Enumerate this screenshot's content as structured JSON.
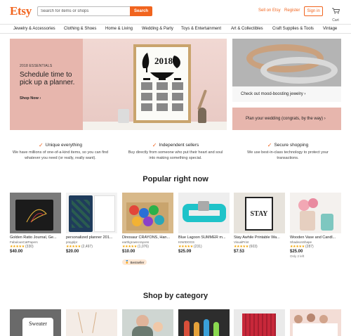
{
  "header": {
    "logo": "Etsy",
    "search_placeholder": "Search for items or shops",
    "search_button": "Search",
    "sell_link": "Sell on Etsy",
    "register_link": "Register",
    "signin_button": "Sign in",
    "cart_label": "Cart"
  },
  "categories_nav": [
    "Jewelry & Accessories",
    "Clothing & Shoes",
    "Home & Living",
    "Wedding & Party",
    "Toys & Entertainment",
    "Art & Collectibles",
    "Craft Supplies & Tools",
    "Vintage"
  ],
  "hero": {
    "eyebrow": "2018 ESSENTIALS",
    "title": "Schedule time to pick up a planner.",
    "cta": "Shop Now",
    "poster_year": "2018",
    "jewelry_caption": "Check out mood-boosting jewelry",
    "wedding_caption": "Plan your wedding (congrats, by the way)"
  },
  "value_props": [
    {
      "title": "Unique everything",
      "text": "We have millions of one-of-a-kind items, so you can find whatever you need (or really, really want)."
    },
    {
      "title": "Independent sellers",
      "text": "Buy directly from someone who put their heart and soul into making something special."
    },
    {
      "title": "Secure shopping",
      "text": "We use best-in-class technology to protect your transactions."
    }
  ],
  "popular": {
    "title": "Popular right now",
    "items": [
      {
        "name": "Golden Ratio Journal, Ge...",
        "shop": "FabulousCatPapers",
        "stars": "★★★★★",
        "count": "(330)",
        "price": "$40.00",
        "extra": "",
        "badge": ""
      },
      {
        "name": "personalized planner 201...",
        "shop": "prayplpr",
        "stars": "★★★★★",
        "count": "(2,497)",
        "price": "$20.00",
        "extra": "",
        "badge": ""
      },
      {
        "name": "Dinosaur CRAYONS, Han...",
        "shop": "earthgrowncrayons",
        "stars": "★★★★★",
        "count": "(1,076)",
        "price": "$10.00",
        "extra": "",
        "badge": "Bestseller"
      },
      {
        "name": "Blue Lagoon SUMMER m...",
        "shop": "KIWIDOGS",
        "stars": "★★★★★",
        "count": "(231)",
        "price": "$25.09",
        "extra": "",
        "badge": ""
      },
      {
        "name": "Stay Awhile Printable Wa...",
        "shop": "VisualPrint",
        "stars": "★★★★★",
        "count": "(603)",
        "price": "$7.53",
        "extra": "",
        "badge": ""
      },
      {
        "name": "Wooden Vase and Candl...",
        "shop": "ShadeonShape",
        "stars": "★★★★★",
        "count": "(287)",
        "price": "$25.00",
        "extra": "Only 2 left",
        "badge": ""
      }
    ],
    "stay_print": "STAY"
  },
  "shop_by_category": {
    "title": "Shop by category",
    "mug_text": "Sweater"
  },
  "colors": {
    "brand": "#f1641e",
    "hero_pink": "#e7b6ad",
    "star": "#f1a400"
  }
}
